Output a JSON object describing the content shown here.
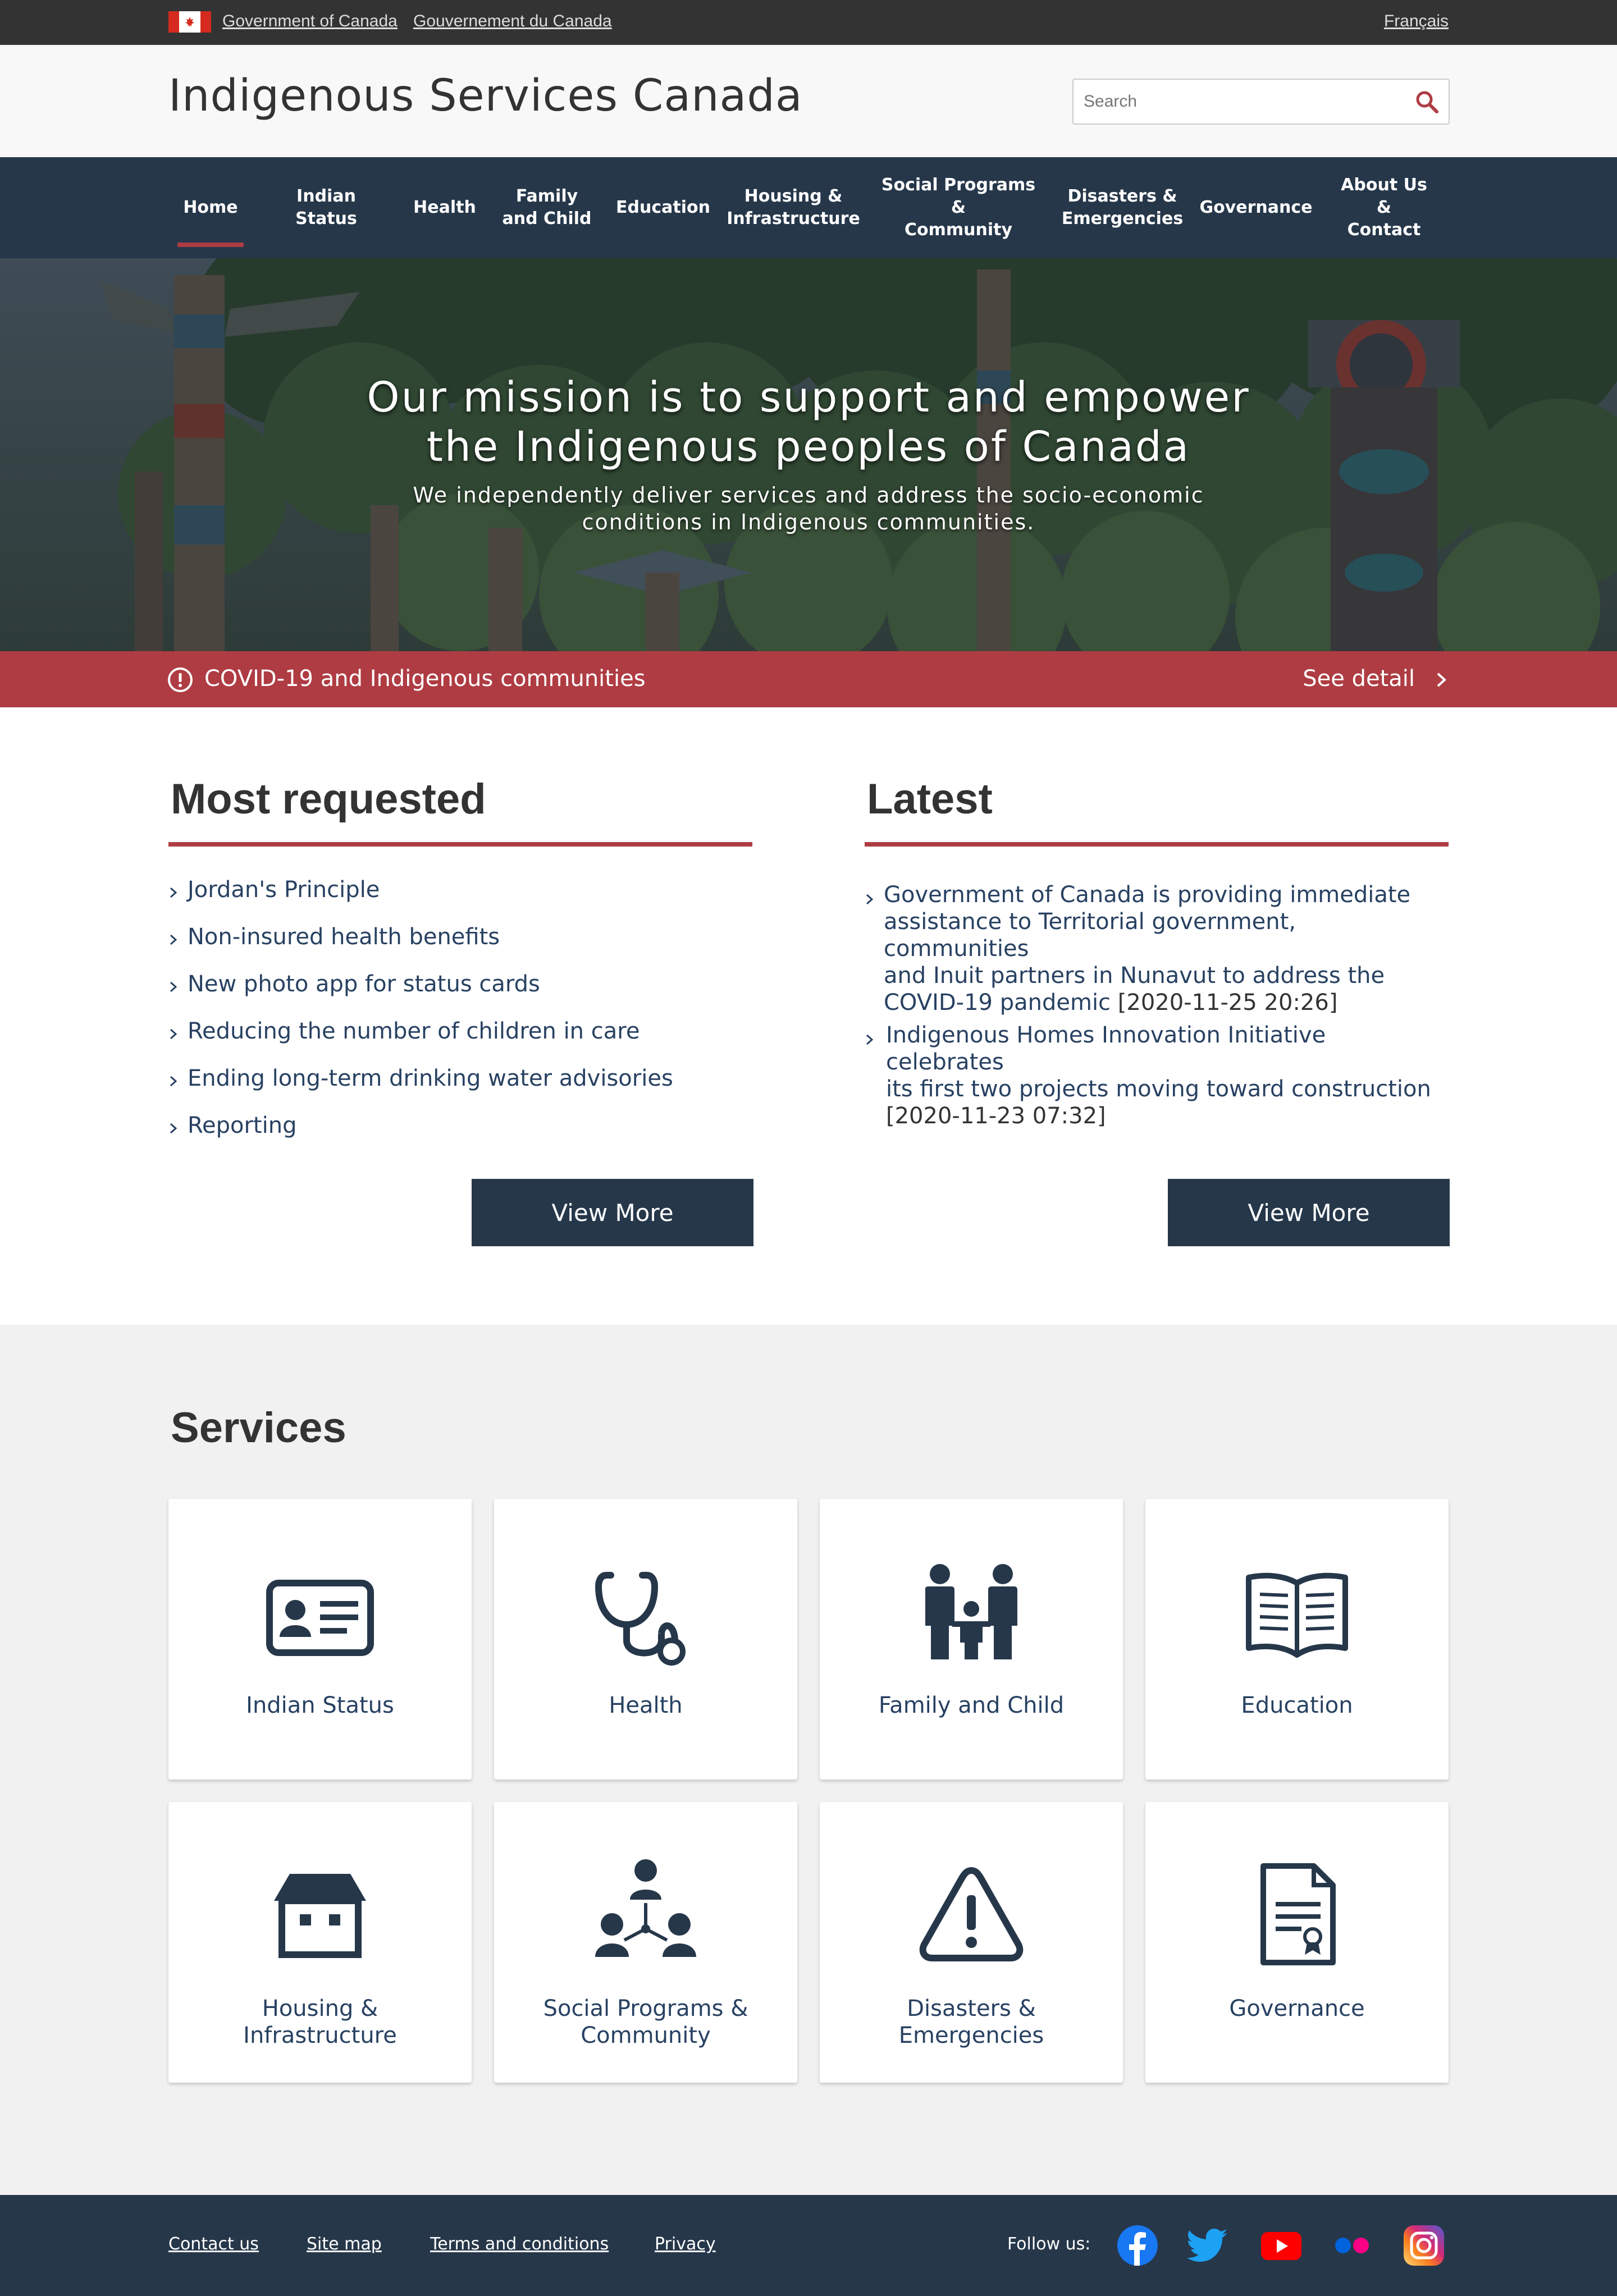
{
  "fedbar": {
    "government_en": "Government of Canada",
    "government_fr": "Gouvernement du Canada",
    "language_link": "Français"
  },
  "header": {
    "site_title": "Indigenous Services Canada",
    "search_placeholder": "Search"
  },
  "nav": {
    "items": [
      {
        "label": "Home",
        "active": true
      },
      {
        "label": "Indian Status"
      },
      {
        "label": "Health"
      },
      {
        "label": "Family\nand Child"
      },
      {
        "label": "Education"
      },
      {
        "label": "Housing &\nInfrastructure"
      },
      {
        "label": "Social Programs &\nCommunity"
      },
      {
        "label": "Disasters &\nEmergencies"
      },
      {
        "label": "Governance"
      },
      {
        "label": "About Us &\nContact"
      }
    ]
  },
  "hero": {
    "title": "Our mission is to support and empower\nthe Indigenous peoples of Canada",
    "subtitle": "We independently deliver services and address the socio-economic\nconditions in Indigenous communities."
  },
  "alert": {
    "text": "COVID-19 and Indigenous communities",
    "link": "See detail"
  },
  "most_requested": {
    "title": "Most requested",
    "items": [
      "Jordan's Principle",
      "Non-insured health benefits",
      "New photo app for status cards",
      "Reducing the number of children in care",
      "Ending long-term drinking water advisories",
      "Reporting"
    ],
    "button": "View More"
  },
  "latest": {
    "title": "Latest",
    "items": [
      {
        "title": "Government of Canada is providing immediate\nassistance to Territorial government, communities\nand Inuit partners in Nunavut to address the\nCOVID-19 pandemic",
        "date": "[2020-11-25 20:26]"
      },
      {
        "title": "Indigenous Homes Innovation Initiative celebrates\nits first two projects moving toward construction",
        "date": "[2020-11-23 07:32]"
      }
    ],
    "button": "View More"
  },
  "services": {
    "title": "Services",
    "cards": [
      {
        "label": "Indian Status",
        "icon": "id-card-icon"
      },
      {
        "label": "Health",
        "icon": "stethoscope-icon"
      },
      {
        "label": "Family and Child",
        "icon": "family-icon"
      },
      {
        "label": "Education",
        "icon": "open-book-icon"
      },
      {
        "label": "Housing &\nInfrastructure",
        "icon": "house-icon"
      },
      {
        "label": "Social Programs &\nCommunity",
        "icon": "community-icon"
      },
      {
        "label": "Disasters &\nEmergencies",
        "icon": "warning-icon"
      },
      {
        "label": "Governance",
        "icon": "certificate-document-icon"
      }
    ]
  },
  "footer": {
    "links": [
      "Contact us",
      "Site map",
      "Terms and conditions",
      "Privacy"
    ],
    "follow_label": "Follow us:",
    "social": [
      "facebook-icon",
      "twitter-icon",
      "youtube-icon",
      "flickr-icon",
      "instagram-icon"
    ]
  },
  "colors": {
    "navy": "#26374a",
    "accent_red": "#af3c43",
    "link_blue": "#284162",
    "fedbar": "#333333"
  }
}
